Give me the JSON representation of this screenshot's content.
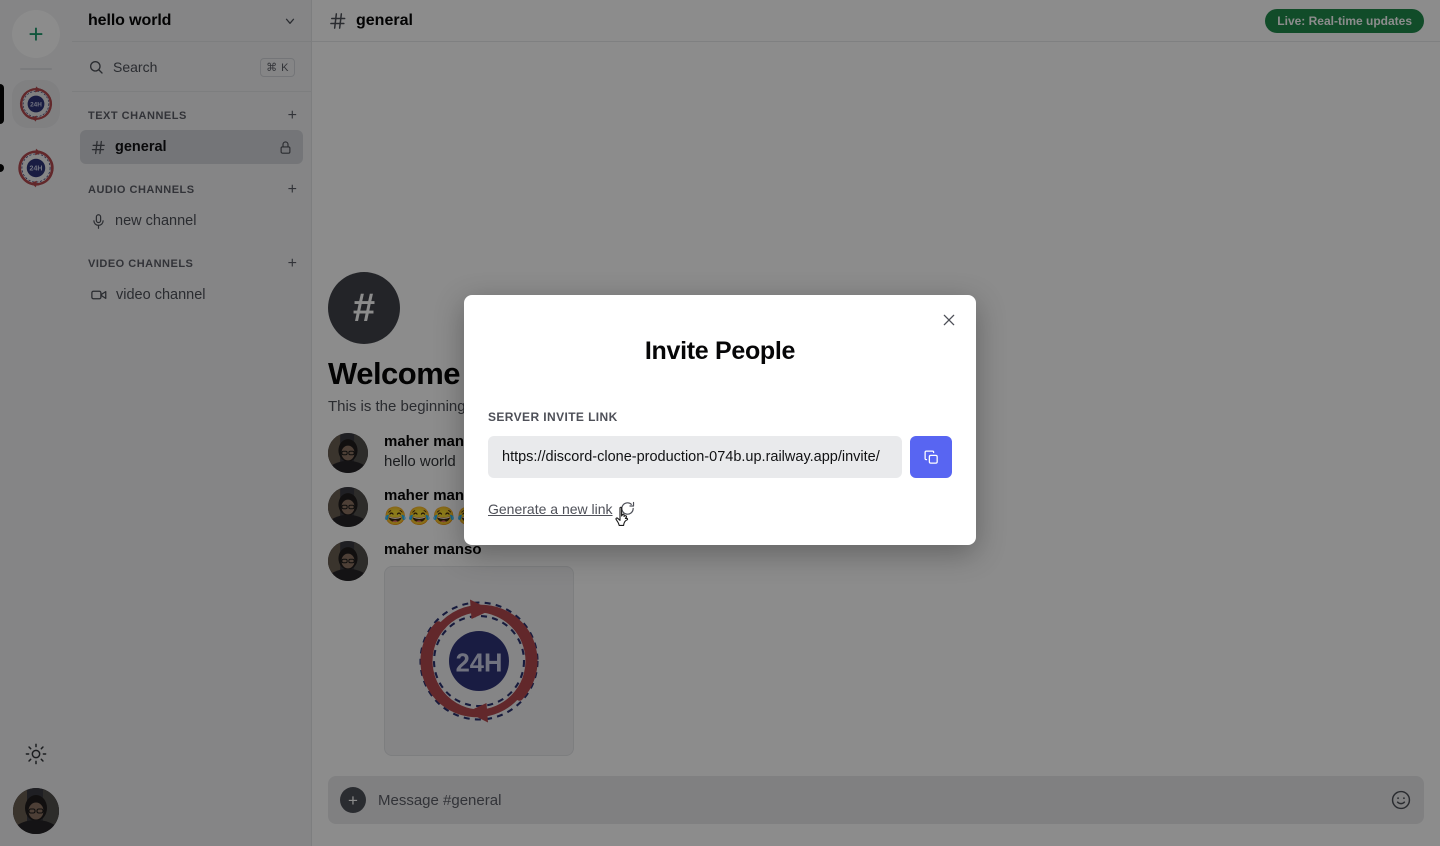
{
  "server_rail": {
    "add_server_button": {
      "label": "+",
      "icon": "plus-icon"
    },
    "servers": [
      {
        "name": "24H",
        "state": "active",
        "logo_text": "24H"
      },
      {
        "name": "24H",
        "state": "idle",
        "logo_text": "24H"
      }
    ],
    "theme_toggle": {
      "icon": "sun-icon",
      "label": "Toggle theme"
    },
    "user_avatar": {
      "label": "maher mansour"
    }
  },
  "sidebar": {
    "server_name": "hello world",
    "chevron": "⌄",
    "search": {
      "label": "Search",
      "icon": "search-icon",
      "shortcut": "⌘ K"
    },
    "categories": [
      {
        "label": "TEXT CHANNELS",
        "add_label": "+",
        "channels": [
          {
            "name": "general",
            "icon": "hash-icon",
            "active": true,
            "locked": true
          }
        ]
      },
      {
        "label": "AUDIO CHANNELS",
        "add_label": "+",
        "channels": [
          {
            "name": "new channel",
            "icon": "microphone-icon",
            "active": false,
            "locked": false
          }
        ]
      },
      {
        "label": "VIDEO CHANNELS",
        "add_label": "+",
        "channels": [
          {
            "name": "video channel",
            "icon": "video-camera-icon",
            "active": false,
            "locked": false
          }
        ]
      }
    ]
  },
  "main": {
    "header": {
      "channel_icon": "hash-icon",
      "channel_name": "general",
      "live_badge": "Live: Real-time updates",
      "live_badge_color": "#1f8b4c"
    },
    "welcome": {
      "icon": "hash-icon",
      "title": "Welcome to #general.",
      "subtitle": "This is the beginning"
    },
    "messages": [
      {
        "author": "maher manso",
        "text": "hello world",
        "type": "text"
      },
      {
        "author": "maher manso",
        "text": "😂😂😂😂",
        "type": "emoji"
      },
      {
        "author": "maher manso",
        "text": "",
        "type": "image",
        "attachment_label": "24H"
      }
    ],
    "composer": {
      "add_icon": "plus-icon",
      "placeholder": "Message #general",
      "value": "",
      "emoji_icon": "smiley-icon"
    }
  },
  "modal": {
    "title": "Invite People",
    "close_label": "×",
    "field_label": "SERVER INVITE LINK",
    "invite_link": "https://discord-clone-production-074b.up.railway.app/invite/",
    "copy_button": {
      "icon": "copy-icon",
      "label": "Copy",
      "color": "#5865f2"
    },
    "generate_link": "Generate a new link",
    "generate_icon": "refresh-icon"
  }
}
